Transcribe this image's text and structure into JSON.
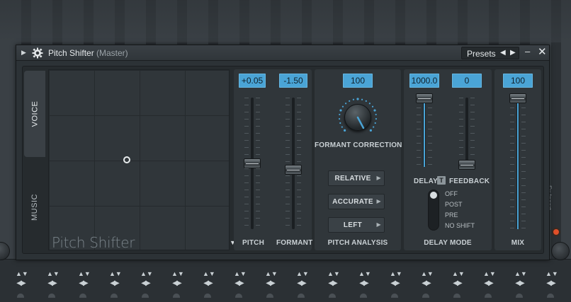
{
  "window": {
    "title": "Pitch Shifter",
    "subtitle": "(Master)",
    "presets_label": "Presets",
    "prev_glyph": "◀",
    "next_glyph": "▶",
    "minimize_glyph": "–",
    "close_glyph": "✕",
    "menu_glyph": "▶"
  },
  "mode_tabs": {
    "voice": "VOICE",
    "music": "MUSIC",
    "active": "VOICE"
  },
  "xy_pad": {
    "label": "Pitch Shifter",
    "dropdown_glyph": "▼"
  },
  "pitch": {
    "value": "+0.05",
    "label": "PITCH",
    "level": 0.5
  },
  "formant": {
    "value": "-1.50",
    "label": "FORMANT",
    "level": 0.45
  },
  "formant_correction": {
    "value": "100",
    "label": "FORMANT CORRECTION"
  },
  "pitch_analysis": {
    "label": "PITCH ANALYSIS",
    "buttons": [
      "RELATIVE",
      "ACCURATE",
      "LEFT"
    ],
    "arrow_glyph": "▶"
  },
  "delay": {
    "value": "1000.0",
    "label": "DELAY",
    "toggle": "T",
    "level": 1.0
  },
  "feedback": {
    "value": "0",
    "label": "FEEDBACK",
    "level": 0.0
  },
  "delay_mode": {
    "label": "DELAY MODE",
    "options": [
      "OFF",
      "POST",
      "PRE",
      "NO SHIFT"
    ],
    "selected": "OFF"
  },
  "mix": {
    "value": "100",
    "label": "MIX",
    "level": 1.0
  },
  "background": {
    "side_text": "Fx Insert",
    "ctrl_updown": "▲▼",
    "ctrl_leftright": "◀▶"
  },
  "colors": {
    "accent": "#4aa4d6",
    "panel": "#30363a",
    "record": "#e0502a"
  }
}
